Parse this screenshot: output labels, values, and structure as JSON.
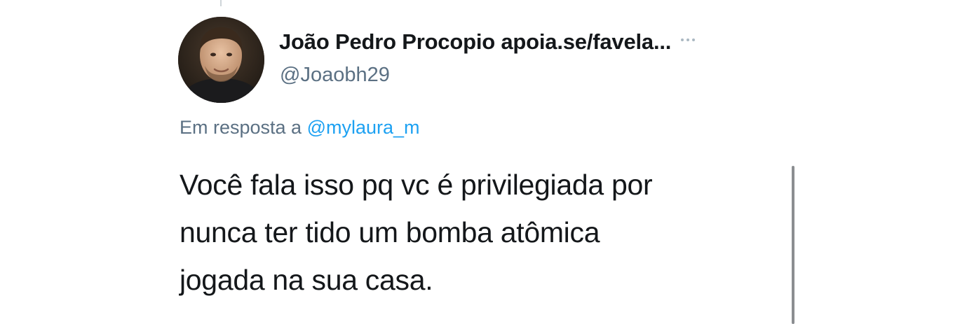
{
  "tweet": {
    "author": {
      "display_name": "João Pedro Procopio apoia.se/favela...",
      "handle": "@Joaobh29",
      "avatar_icon": "profile-photo"
    },
    "more_icon": "ellipsis-icon",
    "reply_context": {
      "prefix": "Em resposta a",
      "mention": "@mylaura_m"
    },
    "text_lines": [
      "Você fala isso pq vc é privilegiada por",
      "nunca ter tido um bomba atômica",
      "jogada na sua casa."
    ]
  },
  "colors": {
    "text_primary": "#14171a",
    "text_secondary": "#5b7083",
    "link": "#1da1f2",
    "background": "#ffffff"
  }
}
